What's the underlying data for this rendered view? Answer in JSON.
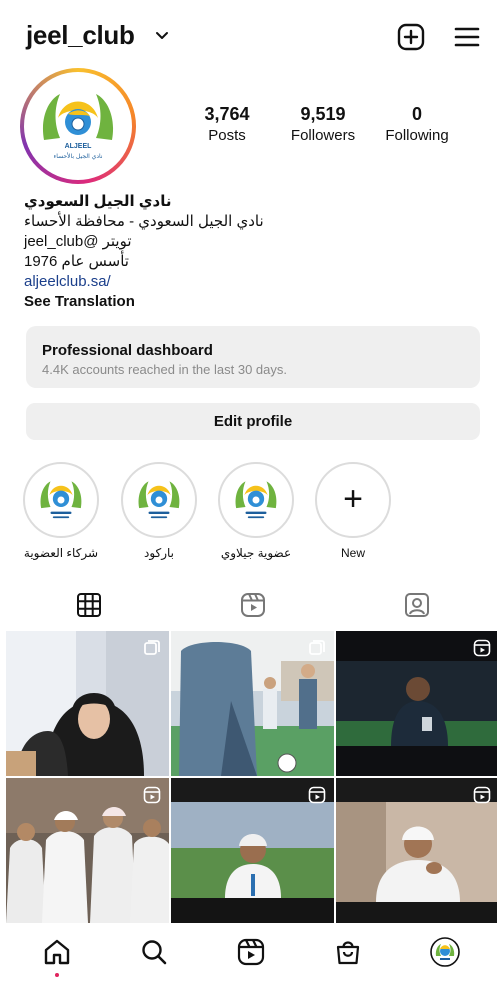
{
  "header": {
    "username": "jeel_club",
    "icons": {
      "chevron": "chevron-down-icon",
      "new_post": "plus-square-icon",
      "menu": "hamburger-menu-icon"
    }
  },
  "profile": {
    "avatar": {
      "logo_text": "ALJEEL",
      "logo_subtext": "نادي الجيل بالأحساء"
    },
    "stats": [
      {
        "value": "3,764",
        "label": "Posts"
      },
      {
        "value": "9,519",
        "label": "Followers"
      },
      {
        "value": "0",
        "label": "Following"
      }
    ],
    "bio": {
      "name": "نادي الجيل السعودي",
      "line1": "نادي الجيل السعودي - محافظة الأحساء",
      "line2": "تويتر @jeel_club",
      "line3": "تأسس عام 1976",
      "link": "aljeelclub.sa/",
      "translate": "See Translation"
    }
  },
  "dashboard": {
    "title": "Professional dashboard",
    "subtitle": "4.4K accounts reached in the last 30 days."
  },
  "edit_profile": "Edit profile",
  "highlights": [
    {
      "label": "شركاء العضوية"
    },
    {
      "label": "باركود"
    },
    {
      "label": "عضوية جيلاوي"
    },
    {
      "label": "New"
    }
  ],
  "tabs": [
    {
      "icon": "grid-icon",
      "active": true
    },
    {
      "icon": "reels-icon",
      "active": false
    },
    {
      "icon": "tagged-person-icon",
      "active": false
    }
  ],
  "grid_posts": [
    {
      "type": "carousel",
      "badge_icon": "carousel-icon"
    },
    {
      "type": "carousel",
      "badge_icon": "carousel-icon"
    },
    {
      "type": "reel",
      "badge_icon": "reels-icon"
    },
    {
      "type": "reel",
      "badge_icon": "reels-icon"
    },
    {
      "type": "reel",
      "badge_icon": "reels-icon"
    },
    {
      "type": "reel",
      "badge_icon": "reels-icon"
    }
  ],
  "bottom_nav": [
    {
      "icon": "home-icon",
      "active": true
    },
    {
      "icon": "search-icon"
    },
    {
      "icon": "reels-icon"
    },
    {
      "icon": "shopping-bag-icon"
    },
    {
      "icon": "profile-avatar-icon"
    }
  ],
  "colors": {
    "link": "#1b3f8b",
    "muted": "#8a8a8a",
    "button_bg": "#efefef",
    "notification_dot": "#e0245e"
  }
}
